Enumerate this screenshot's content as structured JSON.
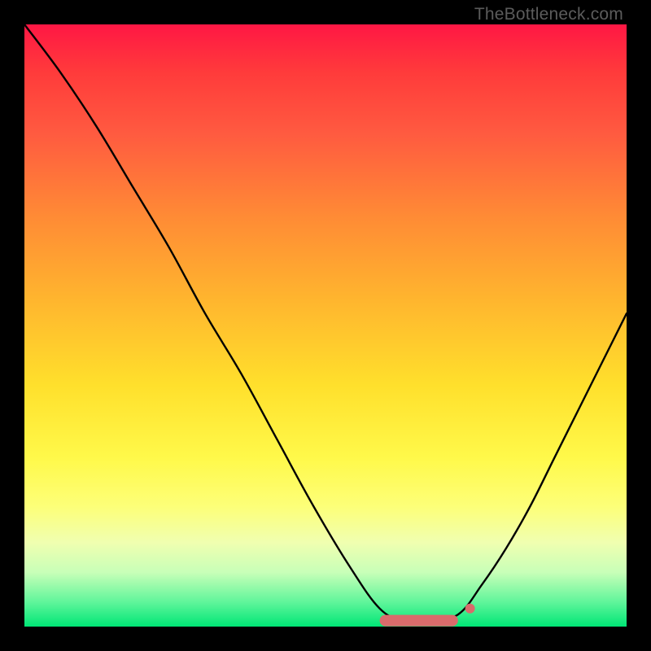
{
  "watermark": "TheBottleneck.com",
  "chart_data": {
    "type": "line",
    "title": "",
    "xlabel": "",
    "ylabel": "",
    "xlim": [
      0,
      100
    ],
    "ylim": [
      0,
      100
    ],
    "grid": false,
    "background_gradient": {
      "top": "#ff1744",
      "mid": "#ffe02c",
      "bottom": "#00e676"
    },
    "series": [
      {
        "name": "bottleneck-curve",
        "color": "#000000",
        "x": [
          0,
          6,
          12,
          18,
          24,
          30,
          36,
          42,
          48,
          54,
          59,
          63,
          67,
          72,
          76,
          80,
          84,
          88,
          92,
          96,
          100
        ],
        "values": [
          100,
          92,
          83,
          73,
          63,
          52,
          42,
          31,
          20,
          10,
          3,
          1,
          1,
          2,
          7,
          13,
          20,
          28,
          36,
          44,
          52
        ]
      }
    ],
    "markers": [
      {
        "name": "flat-min-region",
        "shape": "capsule",
        "x_range": [
          59,
          72
        ],
        "y": 1,
        "color": "#d96b6b"
      },
      {
        "name": "min-end-dot",
        "shape": "dot",
        "x": 74,
        "y": 3,
        "color": "#d96b6b"
      }
    ]
  }
}
